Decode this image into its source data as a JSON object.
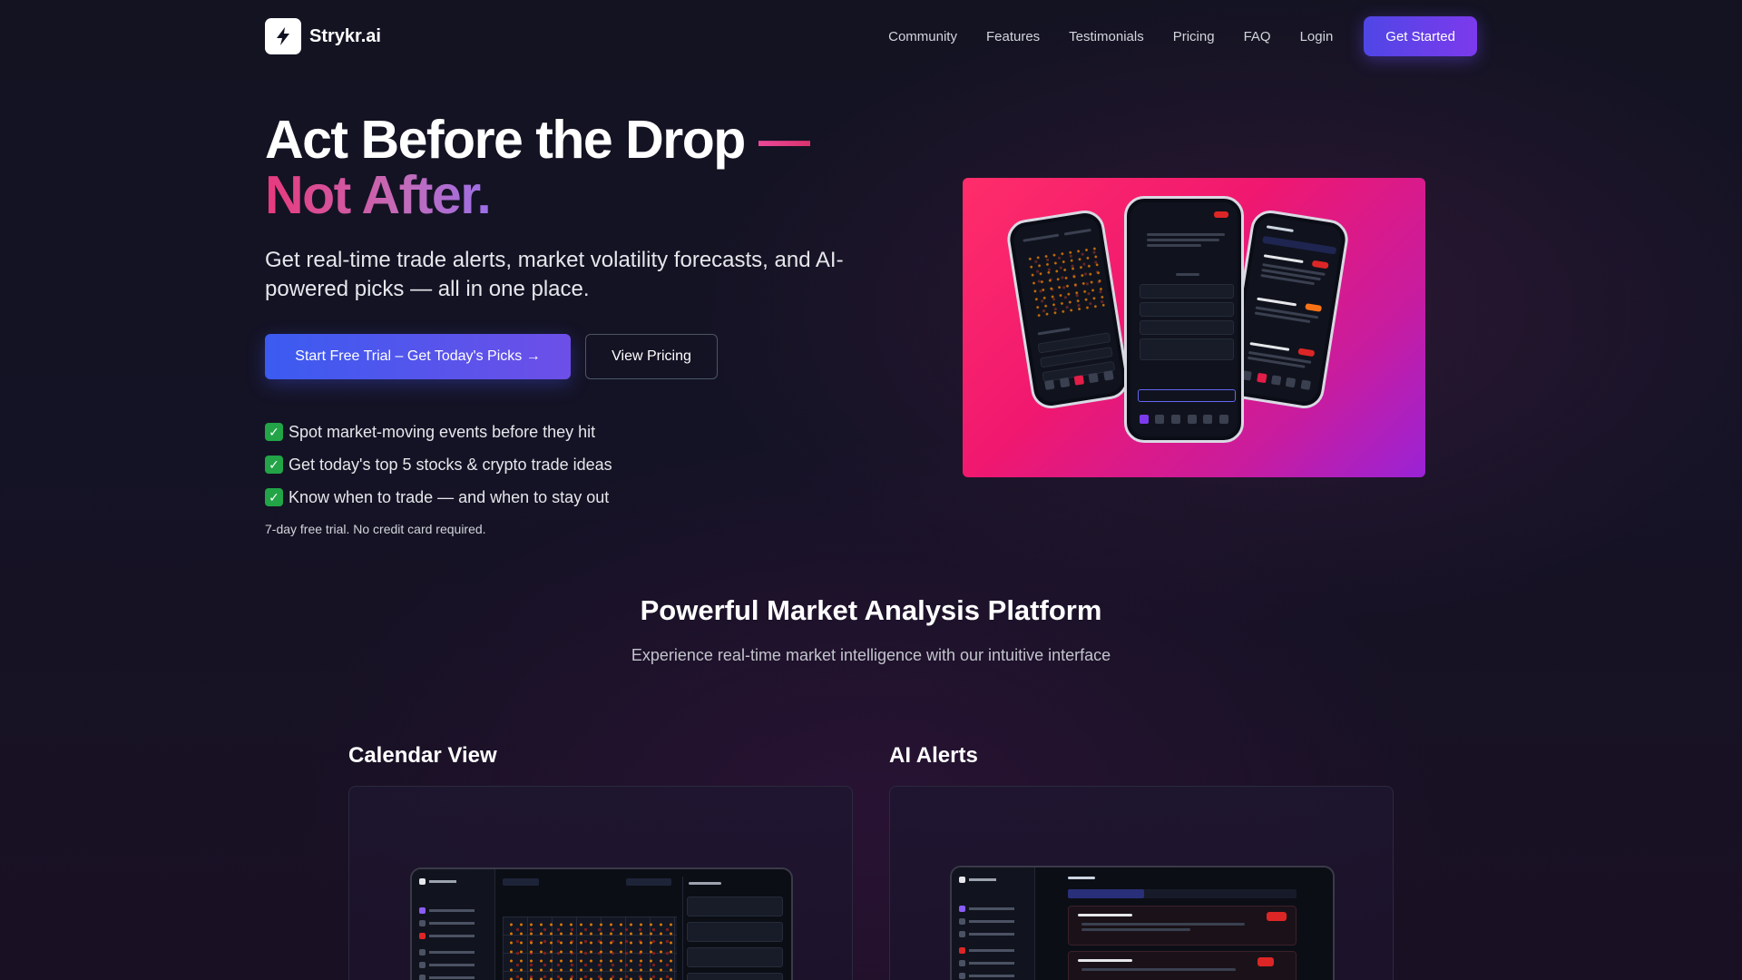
{
  "nav": {
    "brand": "Strykr.ai",
    "links": [
      "Community",
      "Features",
      "Testimonials",
      "Pricing",
      "FAQ",
      "Login"
    ],
    "cta": "Get Started"
  },
  "hero": {
    "title_line1": "Act Before the Drop",
    "title_dash": "—",
    "title_line2": "Not After.",
    "subtitle": "Get real-time trade alerts, market volatility forecasts, and AI-powered picks — all in one place.",
    "primary_cta": "Start Free Trial – Get Today's Picks →",
    "secondary_cta": "View Pricing",
    "features": [
      "Spot market-moving events before they hit",
      "Get today's top 5 stocks & crypto trade ideas",
      "Know when to trade — and when to stay out"
    ],
    "note": "7-day free trial. No credit card required."
  },
  "section": {
    "title": "Powerful Market Analysis Platform",
    "subtitle": "Experience real-time market intelligence with our intuitive interface",
    "cards": [
      {
        "title": "Calendar View"
      },
      {
        "title": "AI Alerts"
      }
    ]
  },
  "colors": {
    "accent_blue": "#4f46e5",
    "accent_purple": "#7c3aed",
    "pink": "#ec4899",
    "check_green": "#22a447"
  },
  "icons": {
    "logo": "lightning-bolt-icon",
    "feature_check": "check-box-icon"
  }
}
